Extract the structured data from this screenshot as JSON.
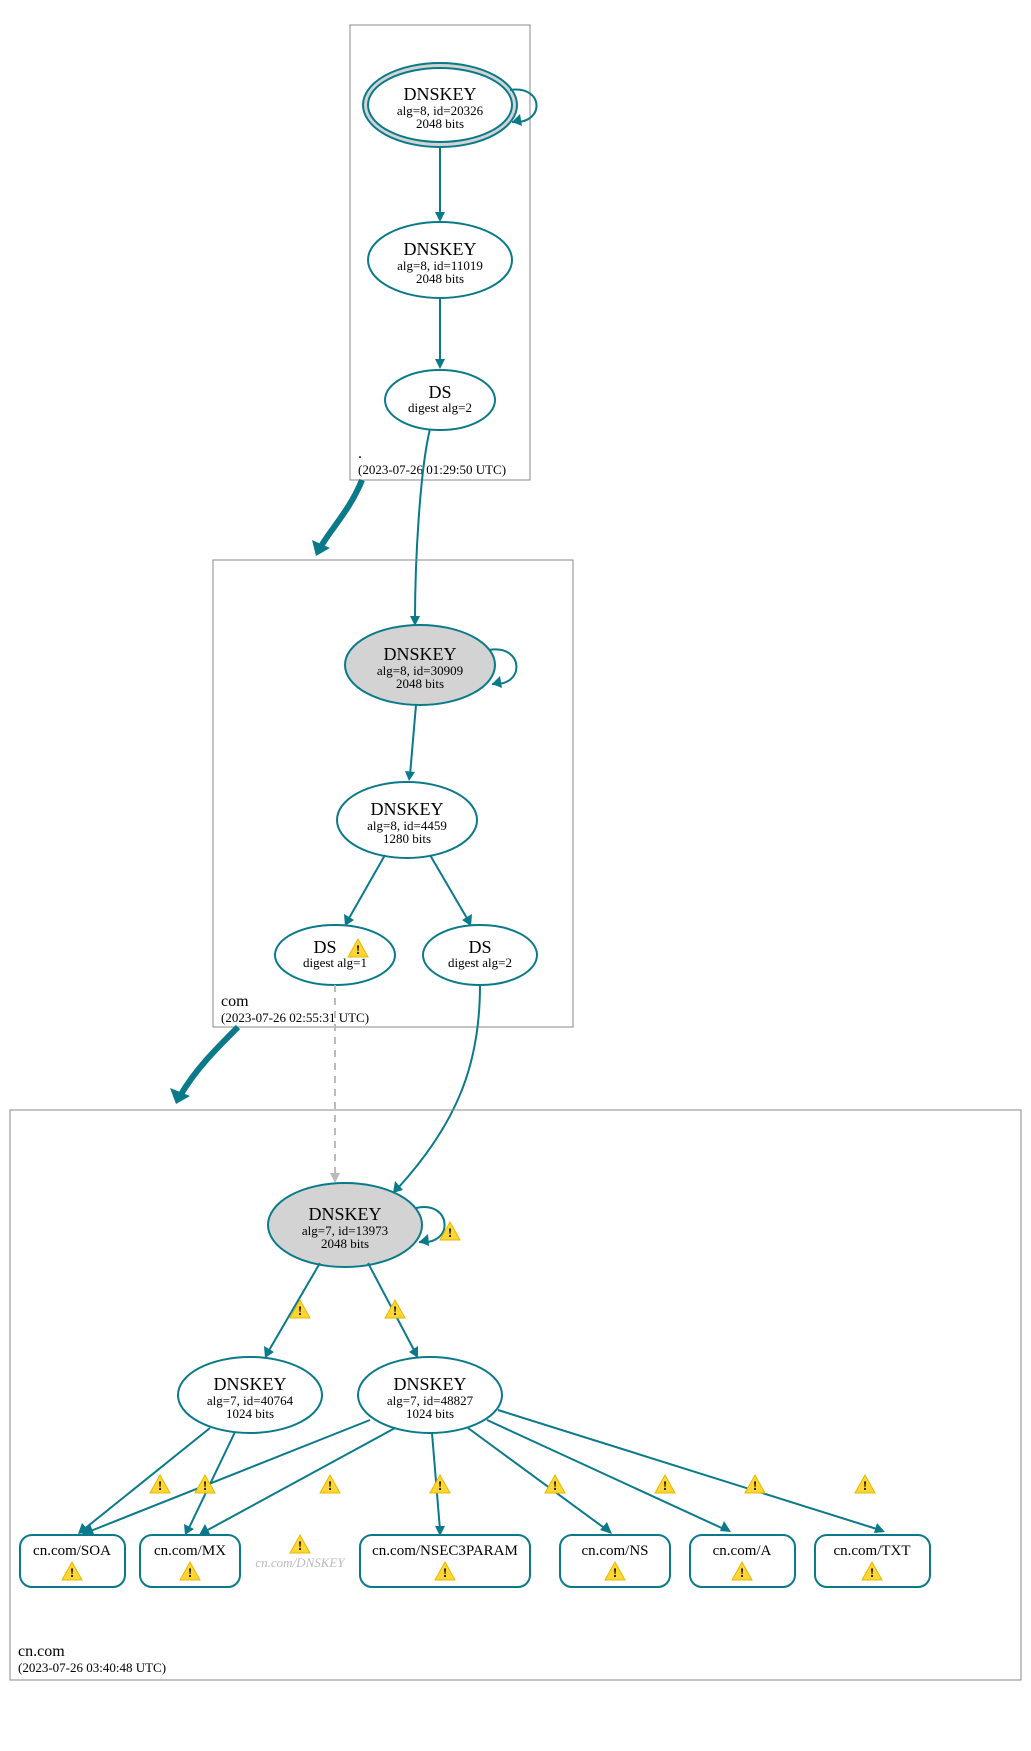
{
  "zones": {
    "root": {
      "label": ".",
      "time": "(2023-07-26 01:29:50 UTC)",
      "nodes": {
        "ksk": {
          "title": "DNSKEY",
          "line2": "alg=8, id=20326",
          "line3": "2048 bits"
        },
        "zsk": {
          "title": "DNSKEY",
          "line2": "alg=8, id=11019",
          "line3": "2048 bits"
        },
        "ds": {
          "title": "DS",
          "line2": "digest alg=2"
        }
      }
    },
    "com": {
      "label": "com",
      "time": "(2023-07-26 02:55:31 UTC)",
      "nodes": {
        "ksk": {
          "title": "DNSKEY",
          "line2": "alg=8, id=30909",
          "line3": "2048 bits"
        },
        "zsk": {
          "title": "DNSKEY",
          "line2": "alg=8, id=4459",
          "line3": "1280 bits"
        },
        "ds1": {
          "title": "DS",
          "line2": "digest alg=1"
        },
        "ds2": {
          "title": "DS",
          "line2": "digest alg=2"
        }
      }
    },
    "cncom": {
      "label": "cn.com",
      "time": "(2023-07-26 03:40:48 UTC)",
      "nodes": {
        "ksk": {
          "title": "DNSKEY",
          "line2": "alg=7, id=13973",
          "line3": "2048 bits"
        },
        "zsk1": {
          "title": "DNSKEY",
          "line2": "alg=7, id=40764",
          "line3": "1024 bits"
        },
        "zsk2": {
          "title": "DNSKEY",
          "line2": "alg=7, id=48827",
          "line3": "1024 bits"
        },
        "phantom": "cn.com/DNSKEY"
      },
      "rrsets": {
        "soa": "cn.com/SOA",
        "mx": "cn.com/MX",
        "nsec3param": "cn.com/NSEC3PARAM",
        "ns": "cn.com/NS",
        "a": "cn.com/A",
        "txt": "cn.com/TXT"
      }
    }
  }
}
